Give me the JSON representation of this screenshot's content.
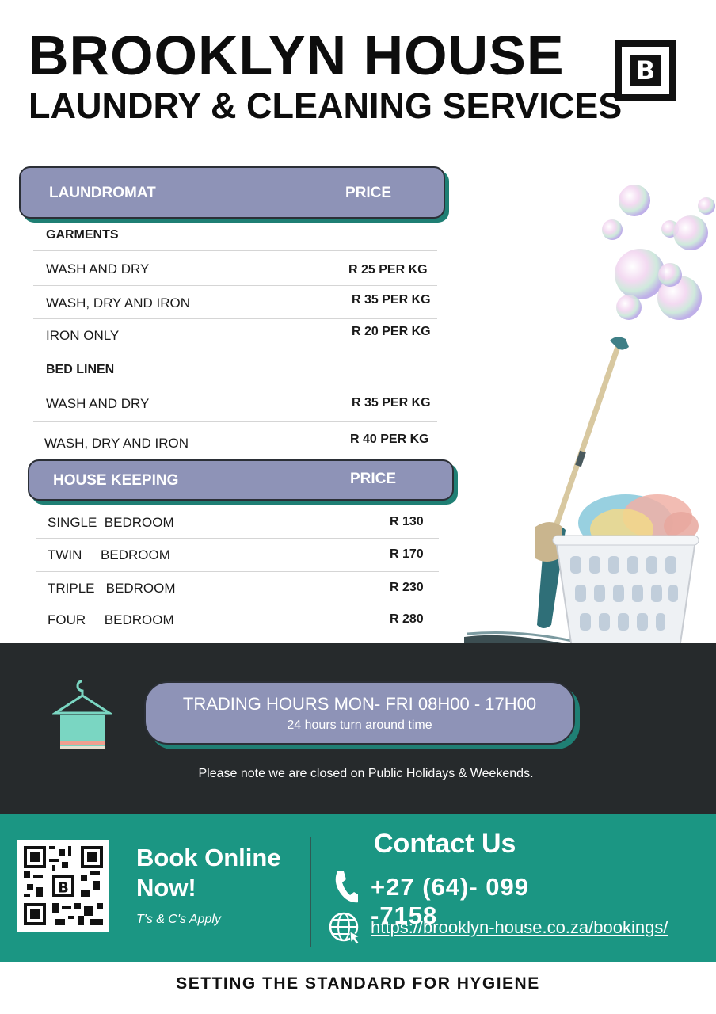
{
  "header": {
    "title": "BROOKLYN HOUSE",
    "subtitle": "LAUNDRY & CLEANING SERVICES",
    "logo_letter": "B"
  },
  "laundromat": {
    "heading": "LAUNDROMAT",
    "price_heading": "PRICE",
    "garments_label": "GARMENTS",
    "garments": [
      {
        "item": "WASH AND DRY",
        "price": "R 25 PER KG"
      },
      {
        "item": "WASH, DRY AND IRON",
        "price": "R 35 PER KG"
      },
      {
        "item": "IRON ONLY",
        "price": "R 20 PER KG"
      }
    ],
    "bed_linen_label": "BED LINEN",
    "bed_linen": [
      {
        "item": "WASH AND DRY",
        "price": "R 35 PER KG"
      },
      {
        "item": "WASH, DRY AND IRON",
        "price": "R 40 PER KG"
      }
    ]
  },
  "housekeeping": {
    "heading": "HOUSE KEEPING",
    "price_heading": "PRICE",
    "rows": [
      {
        "item": "SINGLE  BEDROOM",
        "price": "R 130"
      },
      {
        "item": "TWIN     BEDROOM",
        "price": "R 170"
      },
      {
        "item": "TRIPLE   BEDROOM",
        "price": "R 230"
      },
      {
        "item": "FOUR     BEDROOM",
        "price": "R 280"
      }
    ]
  },
  "hours": {
    "main": "TRADING HOURS MON- FRI 08H00 - 17H00",
    "sub": "24 hours turn around time",
    "note": "Please note we are closed on Public Holidays & Weekends."
  },
  "booking": {
    "line1": "Book Online",
    "line2": "Now!",
    "terms": "T's & C's Apply"
  },
  "contact": {
    "title": "Contact Us",
    "phone": "+27 (64)- 099 -7158",
    "url": "https://brooklyn-house.co.za/bookings/"
  },
  "footer": {
    "tagline": "SETTING THE STANDARD FOR HYGIENE"
  },
  "colors": {
    "pill": "#8e93b7",
    "teal": "#1b9683",
    "dark": "#262a2c"
  }
}
